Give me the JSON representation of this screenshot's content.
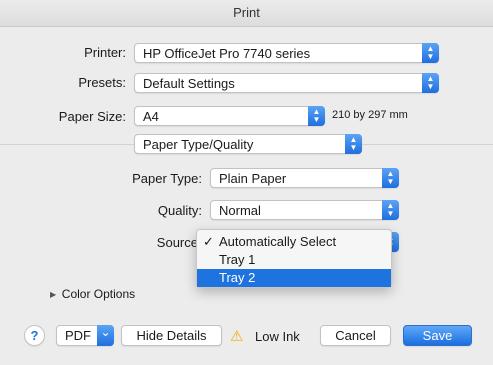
{
  "window": {
    "title": "Print"
  },
  "form": {
    "printer_label": "Printer:",
    "printer_value": "HP OfficeJet Pro 7740 series",
    "presets_label": "Presets:",
    "presets_value": "Default Settings",
    "paper_size_label": "Paper Size:",
    "paper_size_value": "A4",
    "paper_size_dims": "210 by 297 mm",
    "section_value": "Paper Type/Quality",
    "paper_type_label": "Paper Type:",
    "paper_type_value": "Plain Paper",
    "quality_label": "Quality:",
    "quality_value": "Normal",
    "source_label": "Source"
  },
  "source_menu": {
    "items": [
      {
        "label": "Automatically Select",
        "checked": true,
        "highlighted": false
      },
      {
        "label": "Tray 1",
        "checked": false,
        "highlighted": false
      },
      {
        "label": "Tray 2",
        "checked": false,
        "highlighted": true
      }
    ],
    "check_glyph": "✓"
  },
  "color_options": {
    "label": "Color Options",
    "arrow": "▶"
  },
  "footer": {
    "help": "?",
    "pdf_label": "PDF",
    "pdf_arrow": "⌄",
    "hide_details": "Hide Details",
    "warning_icon": "⚠",
    "low_ink": "Low Ink",
    "cancel": "Cancel",
    "save": "Save"
  },
  "colors": {
    "accent": "#1f73df",
    "warning": "#e9b000"
  }
}
